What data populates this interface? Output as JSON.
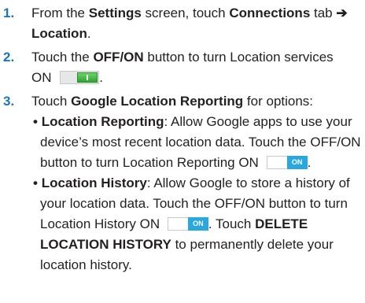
{
  "step1": {
    "number": "1.",
    "t1": "From the ",
    "settings": "Settings",
    "t2": " screen, touch ",
    "connections": "Connections",
    "t3": " tab ",
    "arrow": "➔",
    "location": "Location",
    "t4": "."
  },
  "step2": {
    "number": "2.",
    "t1": "Touch the ",
    "offon": "OFF/ON",
    "t2": " button to turn Location services",
    "on_word": "ON"
  },
  "step3": {
    "number": "3.",
    "t1": "Touch ",
    "glr": "Google Location Reporting",
    "t2": " for options:",
    "bullet1": {
      "dot": "•",
      "title": "Location Reporting",
      "l1": ": Allow Google apps to use your",
      "l2": "device’s most recent location data. Touch the OFF/ON",
      "l3": "button to turn Location Reporting ON",
      "toggle_label": "ON",
      "end": "."
    },
    "bullet2": {
      "dot": "•",
      "title": "Location History",
      "l1": ": Allow Google to store a history of",
      "l2": "your location data. Touch the OFF/ON button to turn",
      "l3a": "Location History ON",
      "toggle_label": "ON",
      "l3b": ". Touch ",
      "delete1": "DELETE",
      "delete2": "LOCATION HISTORY",
      "l4": " to permanently delete your",
      "l5": "location history."
    }
  },
  "colors": {
    "step_number": "#1b75bb",
    "text": "#231f20",
    "toggle_on_green": "#3cb43c",
    "toggle_on_blue": "#29a8e0"
  }
}
